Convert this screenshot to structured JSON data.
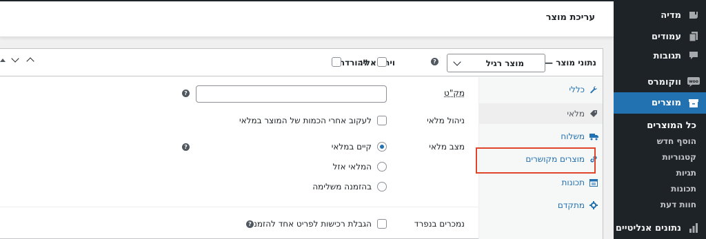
{
  "header": {
    "title": "עריכת מוצר"
  },
  "sidebar": {
    "items": [
      {
        "label": "מדיה",
        "icon": "media-icon"
      },
      {
        "label": "עמודים",
        "icon": "pages-icon"
      },
      {
        "label": "תגובות",
        "icon": "comments-icon"
      },
      {
        "label": "ווקומרס",
        "icon": "woo-icon"
      },
      {
        "label": "מוצרים",
        "icon": "products-icon",
        "active": true
      },
      {
        "label": "נתונים אנליטיים",
        "icon": "analytics-icon"
      }
    ],
    "submenu": [
      "כל המוצרים",
      "הוסף חדש",
      "קטגוריות",
      "תגיות",
      "תכונות",
      "חוות דעת"
    ],
    "accent": "#2271b1"
  },
  "panel": {
    "title": "נתוני מוצר —",
    "product_type": "מוצר רגיל",
    "virtual_label": "וירטואלי:",
    "download_label": "להורדה:",
    "tabs": [
      {
        "label": "כללי",
        "icon": "wrench-icon"
      },
      {
        "label": "מלאי",
        "icon": "tag-icon",
        "active": true
      },
      {
        "label": "משלוח",
        "icon": "truck-icon"
      },
      {
        "label": "מוצרים מקושרים",
        "icon": "link-icon"
      },
      {
        "label": "תכונות",
        "icon": "table-icon"
      },
      {
        "label": "מתקדם",
        "icon": "gear-icon"
      }
    ],
    "fields": {
      "sku_label": "מק\"ט",
      "sku_value": "",
      "manage_stock_label": "ניהול מלאי",
      "manage_stock_text": "לעקוב אחרי הכמות של המוצר במלאי",
      "stock_status_label": "מצב מלאי",
      "stock_options": [
        "קיים במלאי",
        "המלאי אזל",
        "בהזמנה משלימה"
      ],
      "stock_selected": 0,
      "sold_individually_label": "נמכרים בנפרד",
      "sold_individually_text": "הגבלת רכישות לפריט אחד להזמנה"
    }
  }
}
